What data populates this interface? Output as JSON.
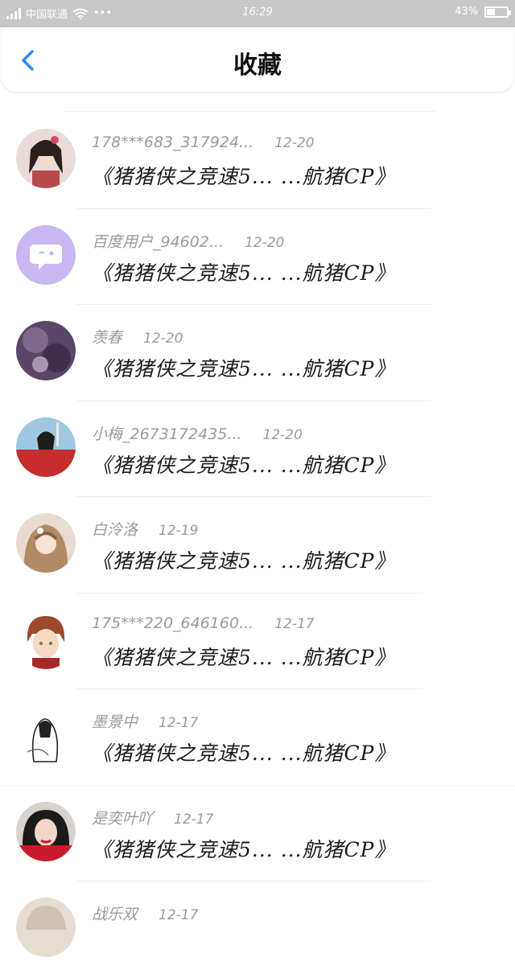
{
  "status_bar": {
    "carrier": "中国联通",
    "dots": "•••",
    "time": "16:29",
    "battery_percent": "43%",
    "battery_level": 0.43
  },
  "header": {
    "title": "收藏",
    "back_icon": "chevron-left-icon",
    "accent_color": "#2d8cf0"
  },
  "items": [
    {
      "user": "178***683_317924...",
      "date": "12-20",
      "headline": "《猪猪侠之竞速5... ...航猪CP》"
    },
    {
      "user": "百度用户_94602...",
      "date": "12-20",
      "headline": "《猪猪侠之竞速5... ...航猪CP》"
    },
    {
      "user": "羡春",
      "date": "12-20",
      "headline": "《猪猪侠之竞速5... ...航猪CP》"
    },
    {
      "user": "小梅_2673172435...",
      "date": "12-20",
      "headline": "《猪猪侠之竞速5... ...航猪CP》"
    },
    {
      "user": "白泠洛",
      "date": "12-19",
      "headline": "《猪猪侠之竞速5... ...航猪CP》"
    },
    {
      "user": "175***220_646160...",
      "date": "12-17",
      "headline": "《猪猪侠之竞速5... ...航猪CP》"
    },
    {
      "user": "墨景中",
      "date": "12-17",
      "headline": "《猪猪侠之竞速5... ...航猪CP》"
    },
    {
      "user": "是奕叶吖",
      "date": "12-17",
      "headline": "《猪猪侠之竞速5... ...航猪CP》"
    },
    {
      "user": "战乐双",
      "date": "12-17",
      "headline": ""
    }
  ]
}
